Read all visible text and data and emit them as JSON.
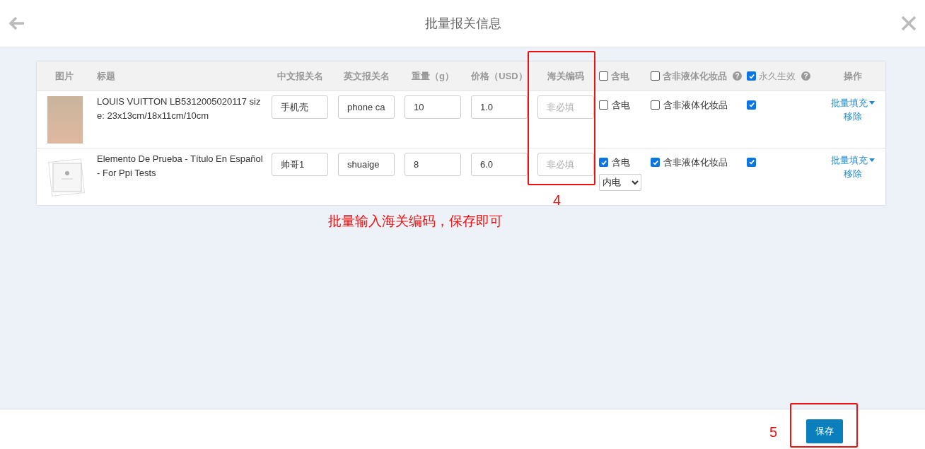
{
  "header": {
    "title": "批量报关信息"
  },
  "table": {
    "columns": [
      {
        "kind": "text",
        "label": "图片"
      },
      {
        "kind": "text",
        "label": "标题"
      },
      {
        "kind": "text",
        "label": "中文报关名"
      },
      {
        "kind": "text",
        "label": "英文报关名"
      },
      {
        "kind": "text",
        "label": "重量（g）"
      },
      {
        "kind": "text",
        "label": "价格（USD）"
      },
      {
        "kind": "text",
        "label": "海关编码"
      },
      {
        "kind": "check",
        "label": "含电",
        "checked": false
      },
      {
        "kind": "check",
        "label": "含非液体化妆品",
        "checked": false,
        "help": "?"
      },
      {
        "kind": "check",
        "label": "永久生效",
        "checked": true,
        "help": "?"
      },
      {
        "kind": "text",
        "label": "操作"
      }
    ],
    "rows": [
      {
        "kind": "photo",
        "title": "LOUIS VUITTON LB5312005020117 size: 23x13cm/18x11cm/10cm",
        "cn_name": "手机壳",
        "en_name": "phone ca",
        "weight": "10",
        "price": "1.0",
        "hs_placeholder": "非必填",
        "battery": {
          "label": "含电",
          "checked": false
        },
        "cosmetic": {
          "label": "含非液体化妆品",
          "checked": false
        },
        "permanent": {
          "checked": true
        },
        "actions": [
          "批量填充",
          "移除"
        ]
      },
      {
        "kind": "placeholder",
        "title": "Elemento De Prueba - Título En Español - For Ppi Tests",
        "cn_name": "帅哥1",
        "en_name": "shuaige",
        "weight": "8",
        "price": "6.0",
        "hs_placeholder": "非必填",
        "battery": {
          "label": "含电",
          "checked": true,
          "type": "内电"
        },
        "cosmetic": {
          "label": "含非液体化妆品",
          "checked": true
        },
        "permanent": {
          "checked": true
        },
        "actions": [
          "批量填充",
          "移除"
        ]
      }
    ]
  },
  "annotations": [
    {
      "kind": "box"
    },
    {
      "kind": "label",
      "text": "4"
    },
    {
      "kind": "note",
      "text": "批量输入海关编码，保存即可"
    },
    {
      "kind": "label",
      "text": "5"
    },
    {
      "kind": "box"
    }
  ],
  "footer": {
    "save": "保存"
  }
}
